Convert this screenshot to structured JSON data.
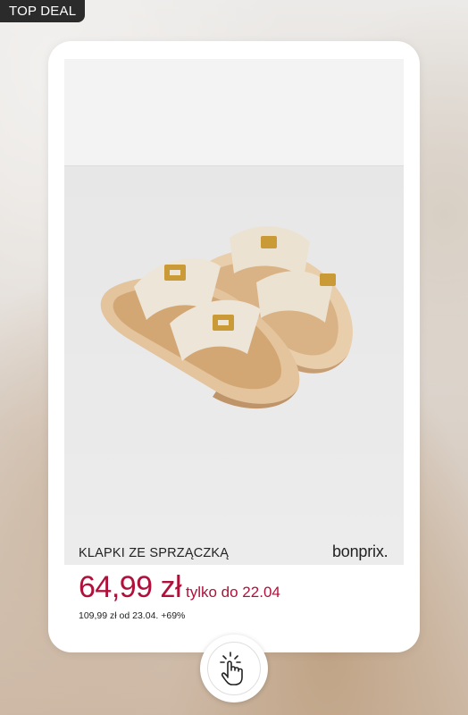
{
  "badge": {
    "label": "TOP DEAL"
  },
  "product": {
    "name": "KLAPKI ZE SPRZĄCZKĄ",
    "brand": "bonprix.",
    "price": "64,99 zł",
    "deal_text": "tylko do 22.04",
    "old_price_text": "109,99 zł od 23.04. +69%",
    "image_alt": "sandals"
  },
  "colors": {
    "price": "#b0113a",
    "badge_bg": "#2b2b2b",
    "card_bg": "#ffffff"
  },
  "icons": {
    "tap": "tap-hand-icon"
  }
}
